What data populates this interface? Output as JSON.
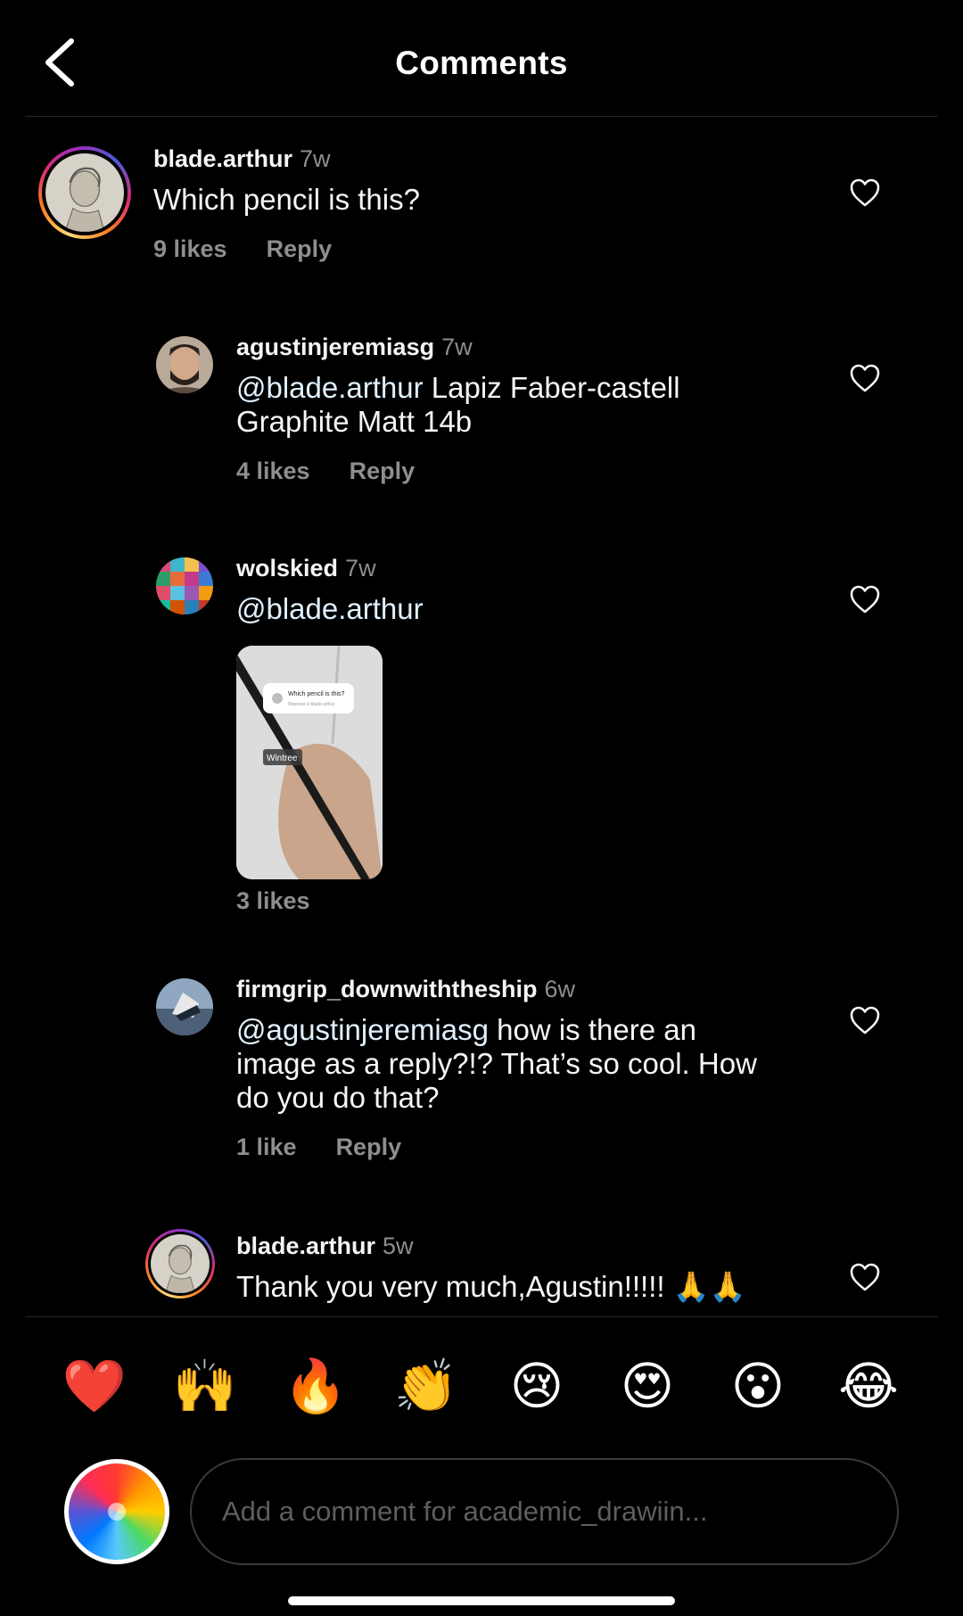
{
  "header": {
    "title": "Comments",
    "back_icon": "chevron-left-icon"
  },
  "comments": [
    {
      "username": "blade.arthur",
      "time": "7w",
      "text": "Which pencil is this?",
      "likes": "9 likes",
      "reply": "Reply"
    },
    {
      "username": "agustinjeremiasg",
      "time": "7w",
      "mention": "@blade.arthur",
      "text_line1": " Lapiz Faber-castell",
      "text_line2": "Graphite Matt 14b",
      "likes": "4 likes",
      "reply": "Reply"
    },
    {
      "username": "wolskied",
      "time": "7w",
      "mention": "@blade.arthur",
      "likes": "3 likes",
      "image": {
        "card_title": "Which pencil is this?",
        "card_sub": "Réponse à blade.arthur",
        "tag": "Wintree"
      }
    },
    {
      "username": "firmgrip_downwiththeship",
      "time": "6w",
      "mention": "@agustinjeremiasg",
      "text_line1": " how is there an",
      "text_line2": "image as a reply?!? That’s so cool. How",
      "text_line3": "do you do that?",
      "likes": "1 like",
      "reply": "Reply"
    },
    {
      "username": "blade.arthur",
      "time": "5w",
      "text": "Thank you very much,Agustin!!!!! 🙏🙏"
    }
  ],
  "emoji_bar": [
    "❤️",
    "🙌",
    "🔥",
    "👏",
    "😢",
    "😍",
    "😮",
    "😂"
  ],
  "composer": {
    "placeholder": "Add a comment for academic_drawiin..."
  },
  "colors": {
    "background": "#000000",
    "secondary_text": "#8e8e8e",
    "divider": "#262626"
  }
}
